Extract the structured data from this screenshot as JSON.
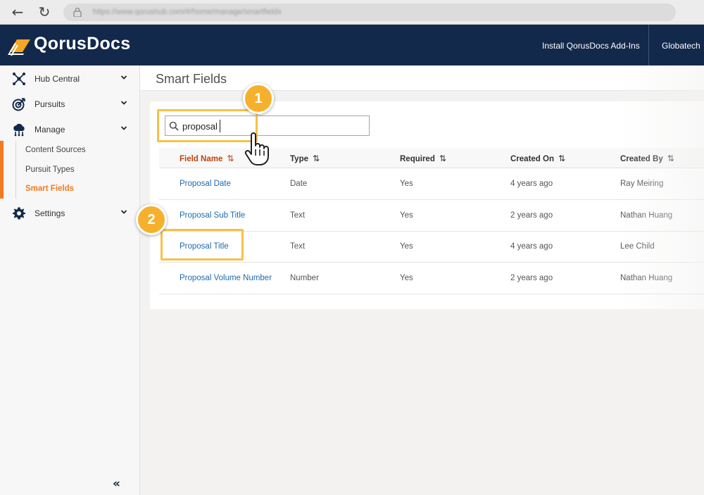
{
  "browser": {
    "url": "https://www.qorushub.com/#/home/manage/smartfields"
  },
  "header": {
    "brand": "QorusDocs",
    "install_link": "Install QorusDocs Add-Ins",
    "org": "Globatech"
  },
  "sidebar": {
    "items": [
      {
        "label": "Hub Central",
        "icon": "hub-network-icon"
      },
      {
        "label": "Pursuits",
        "icon": "target-icon"
      },
      {
        "label": "Manage",
        "icon": "cloud-network-icon"
      },
      {
        "label": "Settings",
        "icon": "gear-icon"
      }
    ],
    "manage_sub": [
      {
        "label": "Content Sources"
      },
      {
        "label": "Pursuit Types"
      },
      {
        "label": "Smart Fields",
        "active": true
      }
    ],
    "collapse": "«"
  },
  "page": {
    "title": "Smart Fields"
  },
  "search": {
    "value": "proposal"
  },
  "table": {
    "columns": [
      "Field Name",
      "Type",
      "Required",
      "Created On",
      "Created By"
    ],
    "rows": [
      [
        "Proposal Date",
        "Date",
        "Yes",
        "4 years ago",
        "Ray Meiring"
      ],
      [
        "Proposal Sub Title",
        "Text",
        "Yes",
        "2 years ago",
        "Nathan Huang"
      ],
      [
        "Proposal Title",
        "Text",
        "Yes",
        "4 years ago",
        "Lee Child"
      ],
      [
        "Proposal Volume Number",
        "Number",
        "Yes",
        "2 years ago",
        "Nathan Huang"
      ]
    ]
  },
  "annotations": {
    "step1": "1",
    "step2": "2"
  },
  "colors": {
    "header_bg": "#13294b",
    "accent_orange": "#f5791f",
    "callout": "#f5b12e",
    "link": "#1f6aae"
  }
}
